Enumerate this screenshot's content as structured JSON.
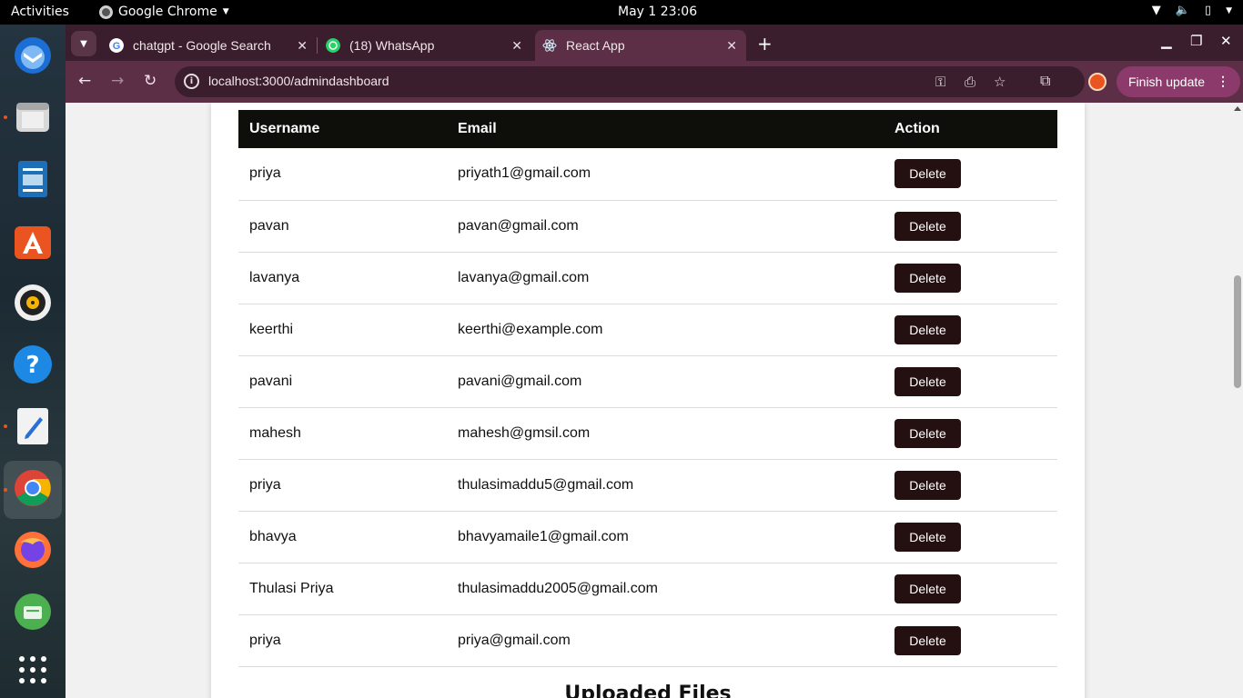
{
  "topbar": {
    "activities": "Activities",
    "app_name": "Google Chrome",
    "clock": "May 1  23:06"
  },
  "dock": {
    "items": [
      "thunderbird-icon",
      "files-icon",
      "writer-icon",
      "app-center-icon",
      "rhythmbox-icon",
      "help-icon",
      "text-editor-icon",
      "chrome-icon",
      "firefox-icon",
      "drive-icon",
      "app-grid-icon"
    ]
  },
  "tabs": [
    {
      "title": "chatgpt - Google Search",
      "favicon": "google-icon",
      "active": false
    },
    {
      "title": "(18) WhatsApp",
      "favicon": "whatsapp-icon",
      "active": false
    },
    {
      "title": "React App",
      "favicon": "react-icon",
      "active": true
    }
  ],
  "toolbar": {
    "url": "localhost:3000/admindashboard",
    "finish_update": "Finish update"
  },
  "table": {
    "headers": [
      "Username",
      "Email",
      "Action"
    ],
    "rows": [
      {
        "username": "priya",
        "email": "priyath1@gmail.com",
        "action": "Delete"
      },
      {
        "username": "pavan",
        "email": "pavan@gmail.com",
        "action": "Delete"
      },
      {
        "username": "lavanya",
        "email": "lavanya@gmail.com",
        "action": "Delete"
      },
      {
        "username": "keerthi",
        "email": "keerthi@example.com",
        "action": "Delete"
      },
      {
        "username": "pavani",
        "email": "pavani@gmail.com",
        "action": "Delete"
      },
      {
        "username": "mahesh",
        "email": "mahesh@gmsil.com",
        "action": "Delete"
      },
      {
        "username": "priya",
        "email": "thulasimaddu5@gmail.com",
        "action": "Delete"
      },
      {
        "username": "bhavya",
        "email": "bhavyamaile1@gmail.com",
        "action": "Delete"
      },
      {
        "username": "Thulasi Priya",
        "email": "thulasimaddu2005@gmail.com",
        "action": "Delete"
      },
      {
        "username": "priya",
        "email": "priya@gmail.com",
        "action": "Delete"
      }
    ]
  },
  "uploaded_files_title": "Uploaded Files",
  "colors": {
    "tabstrip": "#3b1e2e",
    "toolbar": "#5c2f47",
    "header_row": "#0e0f0a",
    "delete_button": "#241010"
  }
}
